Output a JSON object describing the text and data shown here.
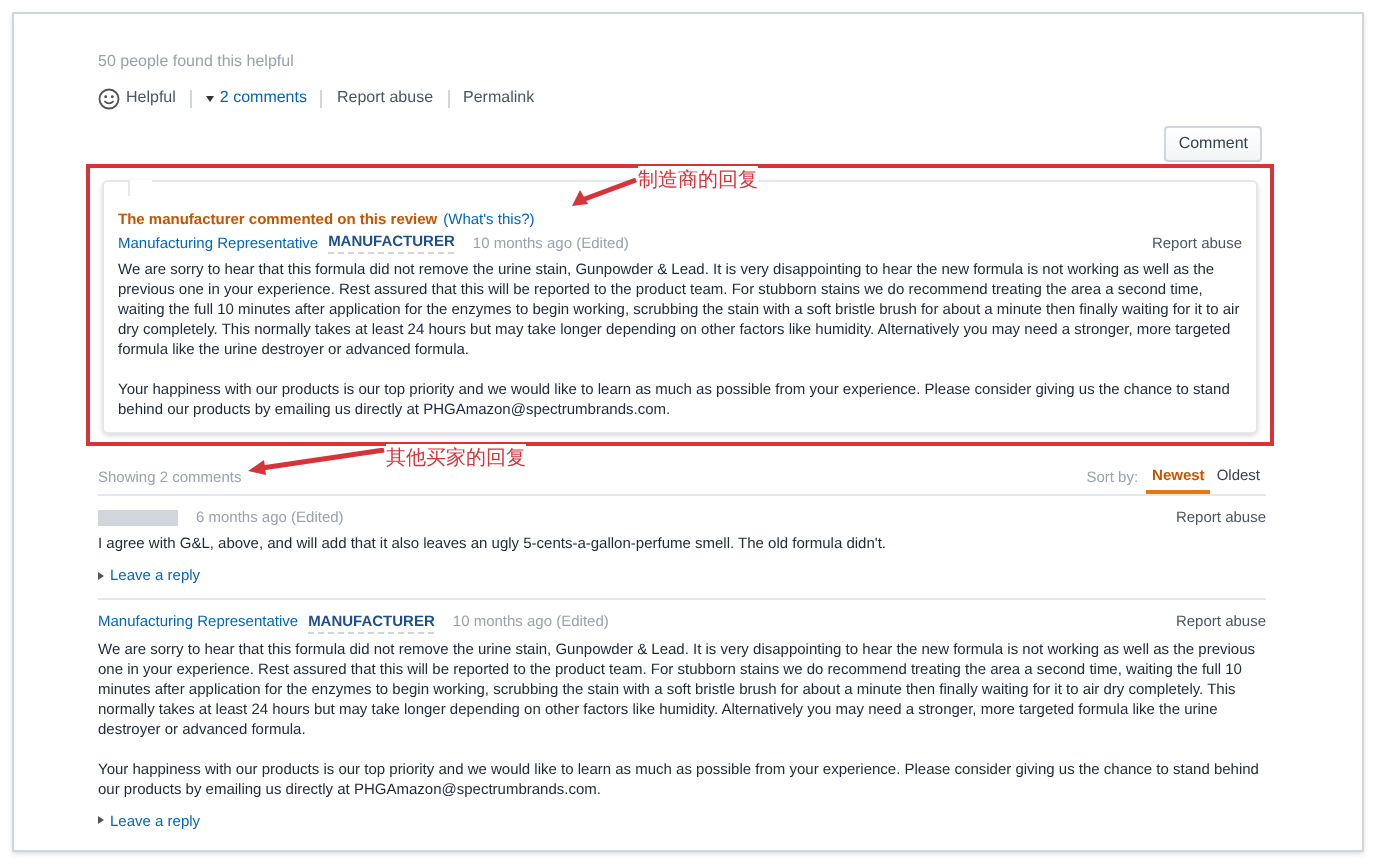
{
  "helpful_count": "50 people found this helpful",
  "actions": [
    {
      "kind": "helpful",
      "label": "Helpful"
    },
    {
      "kind": "comments",
      "label": "2 comments"
    },
    {
      "kind": "link",
      "label": "Report abuse"
    },
    {
      "kind": "link",
      "label": "Permalink"
    }
  ],
  "comment_button": "Comment",
  "manufacturer_comment": {
    "notice": "The manufacturer commented on this review",
    "help_link": "(What's this?)",
    "author": "Manufacturing Representative",
    "badge": "MANUFACTURER",
    "time": "10 months ago (Edited)",
    "report": "Report abuse",
    "paragraphs": [
      "We are sorry to hear that this formula did not remove the urine stain, Gunpowder & Lead. It is very disappointing to hear the new formula is not working as well as the previous one in your experience. Rest assured that this will be reported to the product team. For stubborn stains we do recommend treating the area a second time, waiting the full 10 minutes after application for the enzymes to begin working, scrubbing the stain with a soft bristle brush for about a minute then finally waiting for it to air dry completely. This normally takes at least 24 hours but may take longer depending on other factors like humidity. Alternatively you may need a stronger, more targeted formula like the urine destroyer or advanced formula.",
      "Your happiness with our products is our top priority and we would like to learn as much as possible from your experience. Please consider giving us the chance to stand behind our products by emailing us directly at PHGAmazon@spectrumbrands.com."
    ]
  },
  "comments_header": {
    "count": "Showing 2 comments",
    "sort_label": "Sort by:",
    "sort_options": [
      {
        "label": "Newest",
        "selected": true
      },
      {
        "label": "Oldest",
        "selected": false
      }
    ]
  },
  "comments": [
    {
      "kind": "customer",
      "time": "6 months ago (Edited)",
      "report": "Report abuse",
      "paragraphs": [
        "I agree with G&L, above, and will add that it also leaves an ugly 5-cents-a-gallon-perfume smell. The old formula didn't."
      ],
      "reply": "Leave a reply"
    },
    {
      "kind": "manufacturer",
      "author": "Manufacturing Representative",
      "badge": "MANUFACTURER",
      "time": "10 months ago (Edited)",
      "report": "Report abuse",
      "paragraphs": [
        "We are sorry to hear that this formula did not remove the urine stain, Gunpowder & Lead. It is very disappointing to hear the new formula is not working as well as the previous one in your experience. Rest assured that this will be reported to the product team. For stubborn stains we do recommend treating the area a second time, waiting the full 10 minutes after application for the enzymes to begin working, scrubbing the stain with a soft bristle brush for about a minute then finally waiting for it to air dry completely. This normally takes at least 24 hours but may take longer depending on other factors like humidity. Alternatively you may need a stronger, more targeted formula like the urine destroyer or advanced formula.",
        "Your happiness with our products is our top priority and we would like to learn as much as possible from your experience. Please consider giving us the chance to stand behind our products by emailing us directly at PHGAmazon@spectrumbrands.com."
      ],
      "reply": "Leave a reply"
    }
  ],
  "annotations": [
    {
      "label": "制造商的回复"
    },
    {
      "label": "其他买家的回复"
    }
  ]
}
